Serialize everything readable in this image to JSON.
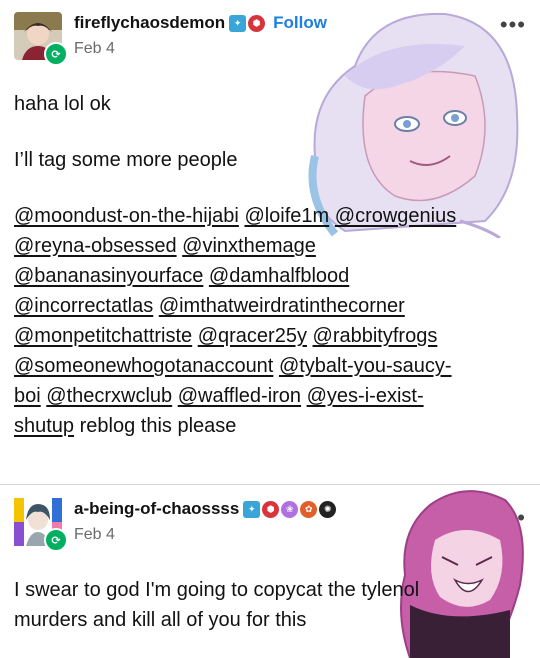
{
  "post1": {
    "username": "fireflychaosdemon",
    "follow_label": "Follow",
    "date": "Feb 4",
    "more_label": "•••",
    "line1": "haha lol ok",
    "line2": "I’ll tag some more people",
    "mentions": [
      "@moondust-on-the-hijabi",
      "@loife1m",
      "@crowgenius",
      "@reyna-obsessed",
      "@vinxthemage",
      "@bananasinyourface",
      "@damhalfblood",
      "@incorrectatlas",
      "@imthatweirdratinthecorner",
      "@monpetitchattriste",
      "@qracer25y",
      "@rabbityfrogs",
      "@someonewhogotanaccount",
      "@tybalt-you-saucy-",
      "boi",
      "@thecrxwclub",
      "@waffled-iron",
      "@yes-i-exist-",
      "shutup"
    ],
    "tail": " reblog this please"
  },
  "post2": {
    "username": "a-being-of-chaossss",
    "date": "Feb 4",
    "more_label": "•••",
    "line1": "I swear to god I'm going to copycat the tylenol",
    "line2": "murders and kill all of you for this"
  },
  "colors": {
    "follow": "#1f7fe0",
    "reblog": "#00b060",
    "text": "#121212",
    "muted": "#6b6b6b"
  },
  "icons": [
    "reblog-icon",
    "badge-icon",
    "more-icon"
  ]
}
